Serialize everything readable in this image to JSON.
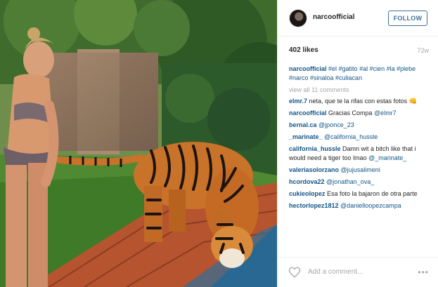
{
  "post": {
    "username": "narcoofficial",
    "follow_label": "FOLLOW",
    "likes": "402 likes",
    "age": "72w",
    "caption_user": "narcoofficial",
    "caption_text": "#el #gatito #al #cien #la #plebe #narco #sinaloa #culiacan",
    "view_all": "view all 11 comments",
    "add_comment_placeholder": "Add a comment...",
    "more_label": "•••"
  },
  "comments": [
    {
      "user": "elmr.7",
      "text": " neta, que te la rifas con estas fotos 👊"
    },
    {
      "user": "narcoofficial",
      "text": " Gracias Compa ",
      "link": "@elmr7"
    },
    {
      "user": "bernal.ca",
      "text": " ",
      "link": "@jponce_23"
    },
    {
      "user": "_marinate_",
      "text": " ",
      "link": "@california_hussle"
    },
    {
      "user": "california_hussle",
      "text": " Damn wit a bitch like that i would need a tiger too lmao ",
      "link": "@_marinate_"
    },
    {
      "user": "valeriasolorzano",
      "text": " ",
      "link": "@jujusalimeni"
    },
    {
      "user": "hcordova22",
      "text": " ",
      "link": "@jonathan_ova_"
    },
    {
      "user": "cukieolopez",
      "text": " Esa foto la bajaron de otra parte"
    },
    {
      "user": "hectorlopez1812",
      "text": " ",
      "link": "@danielloopezcampa"
    }
  ],
  "colors": {
    "link": "#125688",
    "follow": "#3f729b",
    "muted": "#a5a7aa"
  },
  "icons": {
    "heart": "heart-icon",
    "avatar": "avatar"
  }
}
